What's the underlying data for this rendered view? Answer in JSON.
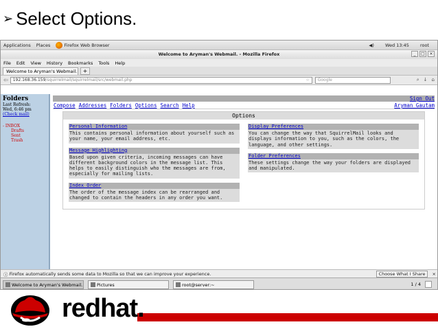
{
  "slide": {
    "bullet": "➢",
    "title": "Select Options."
  },
  "gnome": {
    "applications": "Applications",
    "places": "Places",
    "browser": "Firefox Web Browser",
    "clock": "Wed 13:45",
    "user": "root"
  },
  "window": {
    "title": "Welcome to Aryman's Webmail. - Mozilla Firefox"
  },
  "menu": [
    "File",
    "Edit",
    "View",
    "History",
    "Bookmarks",
    "Tools",
    "Help"
  ],
  "tab": {
    "label": "Welcome to Aryman's Webmail.",
    "new": "+"
  },
  "url": {
    "host": "192.168.36.159",
    "path": "/squirrelmail/squirrelmail/src/webmail.php"
  },
  "search": {
    "placeholder": "Google"
  },
  "sidebar": {
    "title": "Folders",
    "last_refresh": "Last Refresh:",
    "time": "Wed, 6:46 pm",
    "check_mail": "(Check mail)",
    "inbox": "- INBOX",
    "folders": [
      "Drafts",
      "Sent",
      "Trash"
    ]
  },
  "nav": {
    "sign_out": "Sign Out",
    "links": [
      "Compose",
      "Addresses",
      "Folders",
      "Options",
      "Search",
      "Help"
    ],
    "user": "Aryman Gautam"
  },
  "options": {
    "title": "Options",
    "left": [
      {
        "title": "Personal Information",
        "desc": "This contains personal information about yourself such as your name, your email address, etc."
      },
      {
        "title": "Message Highlighting",
        "desc": "Based upon given criteria, incoming messages can have different background colors in the message list. This helps to easily distinguish who the messages are from, especially for mailing lists."
      },
      {
        "title": "Index Order",
        "desc": "The order of the message index can be rearranged and changed to contain the headers in any order you want."
      }
    ],
    "right": [
      {
        "title": "Display Preferences",
        "desc": "You can change the way that SquirrelMail looks and displays information to you, such as the colors, the language, and other settings."
      },
      {
        "title": "Folder Preferences",
        "desc": "These settings change the way your folders are displayed and manipulated."
      }
    ]
  },
  "status": {
    "message": "Firefox automatically sends some data to Mozilla so that we can improve your experience.",
    "button": "Choose What I Share"
  },
  "taskbar": {
    "items": [
      "Welcome to Aryman's Webmail. ...",
      "Pictures",
      "root@server:~"
    ],
    "pager": "1 / 4"
  },
  "footer": {
    "brand": "redhat."
  },
  "colors": {
    "sidebar": "#bcd1e4",
    "link": "#0000cc",
    "accent": "#cc0000"
  }
}
